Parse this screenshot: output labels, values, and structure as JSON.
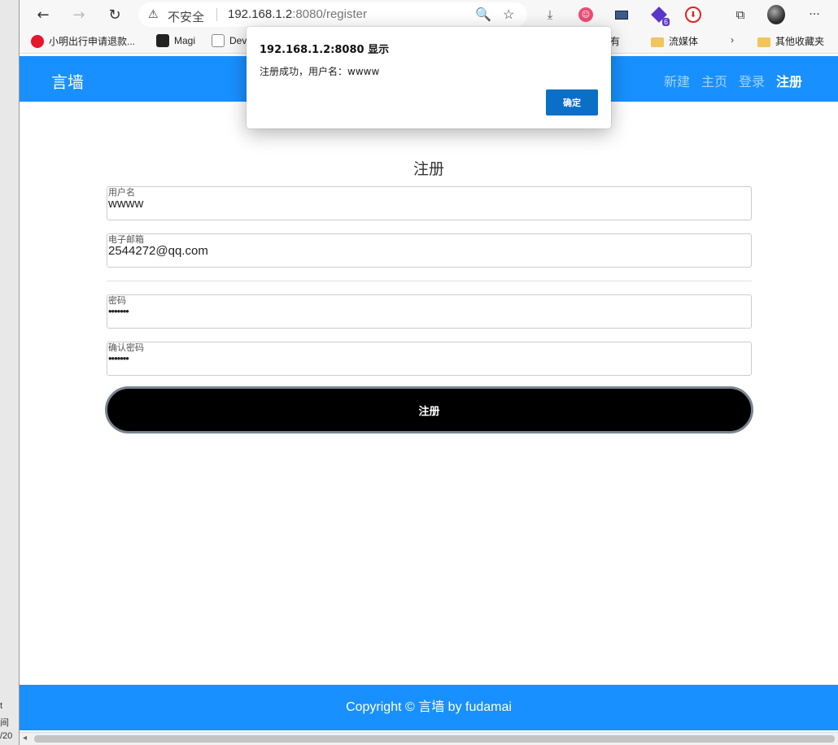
{
  "browser": {
    "back_glyph": "←",
    "forward_glyph": "→",
    "refresh_glyph": "↻",
    "security_label": "不安全",
    "url_host": "192.168.1.2",
    "url_rest": ":8080/register",
    "more_glyph": "···"
  },
  "bookmarks": [
    {
      "label": "小明出行申请退款...",
      "icon": "weibo-icon"
    },
    {
      "label": "Magi",
      "icon": "magi-icon"
    },
    {
      "label": "Dev",
      "icon": "dev-icon"
    },
    {
      "label": "国有",
      "icon": "folder-icon"
    },
    {
      "label": "流媒体",
      "icon": "folder-icon"
    },
    {
      "label": "其他收藏夹",
      "icon": "folder-icon"
    }
  ],
  "left_fragments": [
    "t",
    "间",
    "/20"
  ],
  "header": {
    "brand": "言墙",
    "nav": [
      "新建",
      "主页",
      "登录",
      "注册"
    ],
    "active_nav": "注册"
  },
  "form": {
    "title": "注册",
    "username": {
      "label": "用户名",
      "value": "wwww"
    },
    "email": {
      "label": "电子邮箱",
      "value": "2544272@qq.com"
    },
    "password": {
      "label": "密码",
      "value": "•••••••"
    },
    "confirm_password": {
      "label": "确认密码",
      "value": "•••••••"
    },
    "submit_label": "注册"
  },
  "footer": {
    "text": "Copyright © 言墙 by fudamai"
  },
  "dialog": {
    "origin": "192.168.1.2:8080 显示",
    "message": "注册成功，用户名：wwww",
    "ok_label": "确定"
  },
  "colors": {
    "brand_blue": "#1890ff",
    "dialog_button": "#0b6fc7",
    "submit_bg": "#000000"
  }
}
